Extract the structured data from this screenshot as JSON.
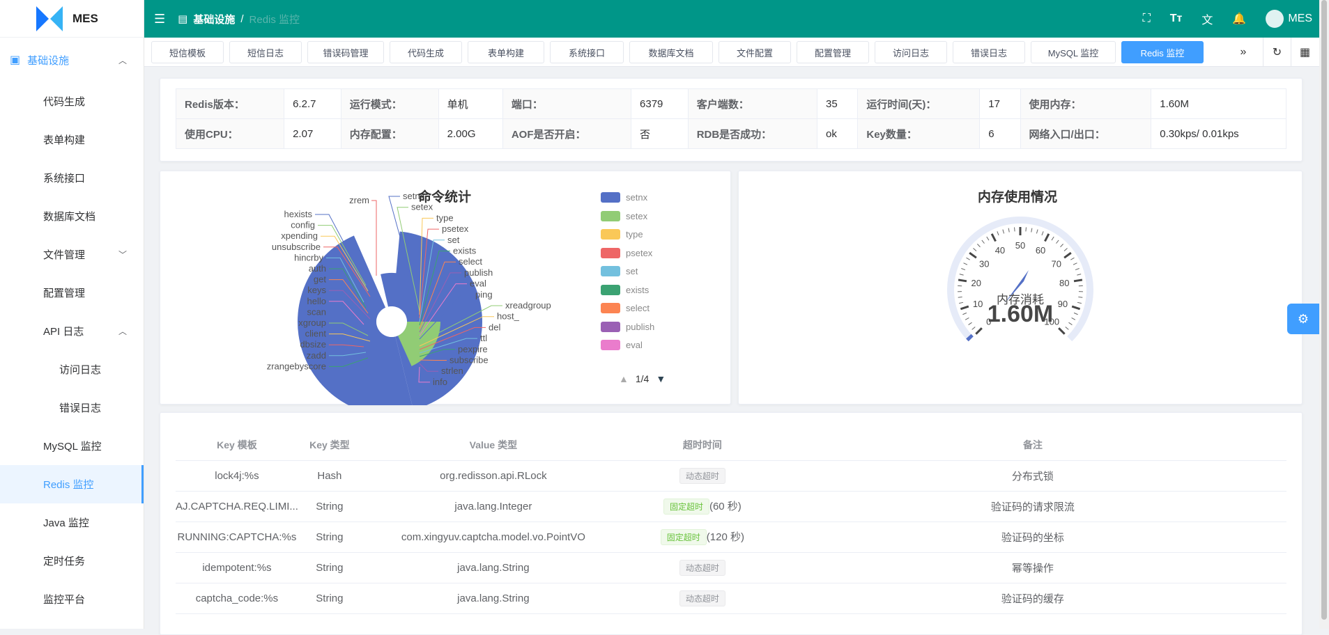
{
  "app": {
    "brand": "MES"
  },
  "sidebar": {
    "group": "基础设施",
    "items": [
      "代码生成",
      "表单构建",
      "系统接口",
      "数据库文档",
      "文件管理",
      "配置管理",
      "API 日志",
      "访问日志",
      "错误日志",
      "MySQL 监控",
      "Redis 监控",
      "Java 监控",
      "定时任务",
      "监控平台"
    ]
  },
  "header": {
    "crumb_root": "基础设施",
    "crumb_current": "Redis 监控",
    "user": "MES"
  },
  "tabs": [
    "短信模板",
    "短信日志",
    "错误码管理",
    "代码生成",
    "表单构建",
    "系统接口",
    "数据库文档",
    "文件配置",
    "配置管理",
    "访问日志",
    "错误日志",
    "MySQL 监控",
    "Redis 监控"
  ],
  "info": {
    "row1": [
      [
        "Redis版本：",
        "6.2.7"
      ],
      [
        "运行模式：",
        "单机"
      ],
      [
        "端口：",
        "6379"
      ],
      [
        "客户端数：",
        "35"
      ],
      [
        "运行时间(天)：",
        "17"
      ],
      [
        "使用内存：",
        "1.60M"
      ]
    ],
    "row2": [
      [
        "使用CPU：",
        "2.07"
      ],
      [
        "内存配置：",
        "2.00G"
      ],
      [
        "AOF是否开启：",
        "否"
      ],
      [
        "RDB是否成功：",
        "ok"
      ],
      [
        "Key数量：",
        "6"
      ],
      [
        "网络入口/出口：",
        "0.30kps/ 0.01kps"
      ]
    ]
  },
  "cmd_title": "命令统计",
  "mem_title": "内存使用情况",
  "chart_data": [
    {
      "type": "pie",
      "title": "命令统计",
      "labels_left": [
        "hexists",
        "config",
        "xpending",
        "unsubscribe",
        "hincrby",
        "auth",
        "get",
        "keys",
        "hello",
        "scan",
        "xgroup",
        "client",
        "dbsize",
        "zadd",
        "zrangebyscore"
      ],
      "labels_right": [
        "setnx",
        "setex",
        "type",
        "psetex",
        "set",
        "exists",
        "select",
        "publish",
        "eval",
        "ping",
        "xreadgroup",
        "host_",
        "del",
        "ttl",
        "pexpire",
        "subscribe",
        "strlen",
        "info"
      ],
      "top_labels": [
        "zrem",
        "setnx"
      ],
      "legend": [
        {
          "name": "setnx",
          "color": "#5470c6"
        },
        {
          "name": "setex",
          "color": "#91cc75"
        },
        {
          "name": "type",
          "color": "#fac858"
        },
        {
          "name": "psetex",
          "color": "#ee6666"
        },
        {
          "name": "set",
          "color": "#73c0de"
        },
        {
          "name": "exists",
          "color": "#3ba272"
        },
        {
          "name": "select",
          "color": "#fc8452"
        },
        {
          "name": "publish",
          "color": "#9a60b4"
        },
        {
          "name": "eval",
          "color": "#ea7ccc"
        }
      ],
      "legend_page": "1/4"
    },
    {
      "type": "gauge",
      "title": "内存使用情况",
      "detail": "内存消耗",
      "value_label": "1.60M",
      "ticks": [
        "0",
        "10",
        "20",
        "30",
        "40",
        "50",
        "60",
        "70",
        "80",
        "90",
        "100"
      ]
    }
  ],
  "keys": {
    "headers": [
      "Key 模板",
      "Key 类型",
      "Value 类型",
      "超时时间",
      "备注"
    ],
    "rows": [
      {
        "k": "lock4j:%s",
        "t": "Hash",
        "v": "org.redisson.api.RLock",
        "tag": "动态超时",
        "tagc": "grey",
        "extra": "",
        "note": "分布式锁"
      },
      {
        "k": "AJ.CAPTCHA.REQ.LIMI...",
        "t": "String",
        "v": "java.lang.Integer",
        "tag": "固定超时",
        "tagc": "green",
        "extra": "(60 秒)",
        "note": "验证码的请求限流"
      },
      {
        "k": "RUNNING:CAPTCHA:%s",
        "t": "String",
        "v": "com.xingyuv.captcha.model.vo.PointVO",
        "tag": "固定超时",
        "tagc": "green",
        "extra": "(120 秒)",
        "note": "验证码的坐标"
      },
      {
        "k": "idempotent:%s",
        "t": "String",
        "v": "java.lang.String",
        "tag": "动态超时",
        "tagc": "grey",
        "extra": "",
        "note": "幂等操作"
      },
      {
        "k": "captcha_code:%s",
        "t": "String",
        "v": "java.lang.String",
        "tag": "动态超时",
        "tagc": "grey",
        "extra": "",
        "note": "验证码的缓存"
      }
    ]
  }
}
